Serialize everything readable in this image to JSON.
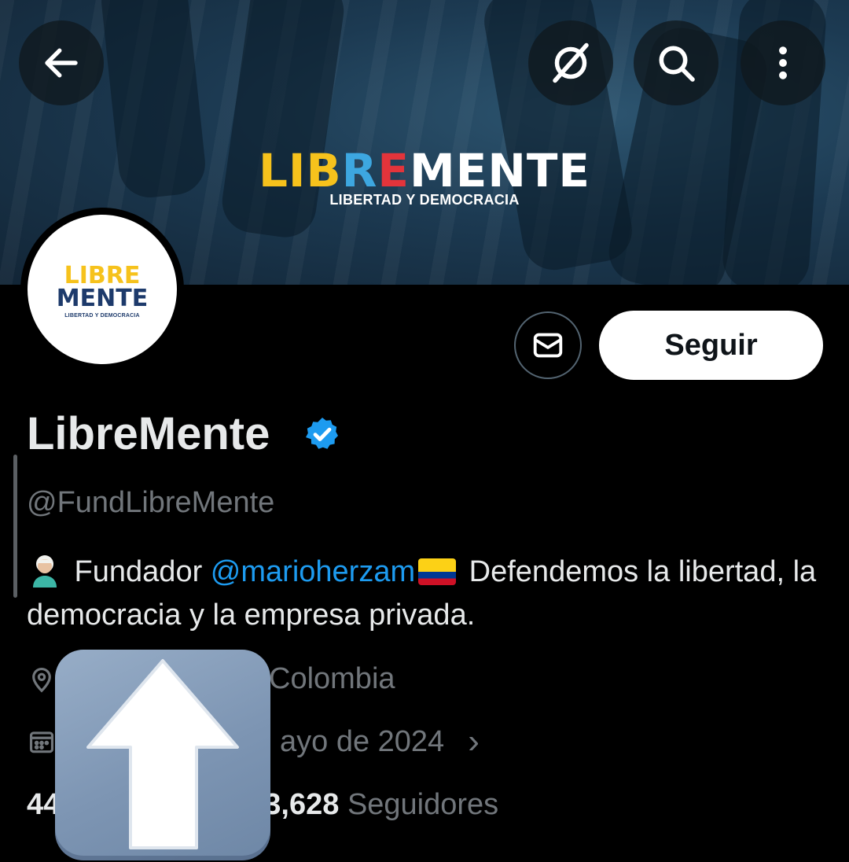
{
  "banner": {
    "logo_part1": "LIB",
    "logo_part2": "R",
    "logo_part3": "E",
    "logo_part4": "MENTE",
    "tagline": "LIBERTAD Y DEMOCRACIA"
  },
  "header": {
    "back_icon": "arrow-left-icon",
    "grok_icon": "grok-icon",
    "search_icon": "search-icon",
    "more_icon": "more-vertical-icon"
  },
  "avatar": {
    "line1": "LIBRE",
    "line2": "MENTE",
    "subtitle": "LIBERTAD Y DEMOCRACIA"
  },
  "actions": {
    "message_icon": "mail-icon",
    "follow_label": "Seguir"
  },
  "profile": {
    "name": "LibreMente",
    "handle": "@FundLibreMente",
    "bio_part1": " Fundador ",
    "bio_mention": "@marioherzam",
    "bio_part2": " Defendemos la libertad, la democracia y la empresa privada.",
    "location_visible": "Colombia",
    "joined_visible": "ayo de 2024",
    "joined_chevron": "›"
  },
  "stats": {
    "following_partial": "44",
    "followers_partial": "3,628",
    "followers_label": "Seguidores"
  },
  "overlay": {
    "icon": "up-arrow-icon"
  },
  "colors": {
    "accent": "#1d9bf0",
    "background": "#000000",
    "secondary_text": "#71767b"
  }
}
